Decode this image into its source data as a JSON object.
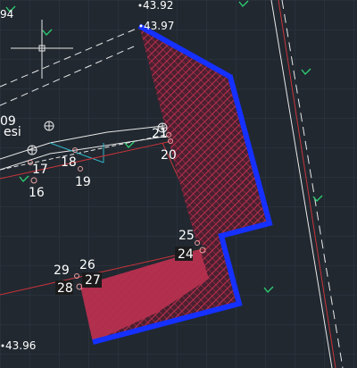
{
  "cad": {
    "elevations": {
      "top_left": "94",
      "top_mark_1": "43.92",
      "top_mark_2": "43.97",
      "bottom_left": "43.96"
    },
    "point_labels": {
      "p09": "09",
      "p16": "16",
      "p17": "17",
      "p18": "18",
      "p19": "19",
      "p20": "20",
      "p21": "21",
      "p24": "24",
      "p25": "25",
      "p26": "26",
      "p27": "27",
      "p28": "28",
      "p29": "29"
    },
    "partial_text": "esi",
    "colors": {
      "background": "#212830",
      "grid": "#2e3944",
      "boundary_blue": "#1530ff",
      "hatch_red": "#c0304f",
      "fill_red": "#b5304f",
      "red_line": "#c8343a",
      "white_line": "#e8e8e8",
      "vegetation": "#2ecc71",
      "cyan_line": "#2fb6c8"
    },
    "icons": [
      "crosshair-cursor-icon",
      "vegetation-symbol-icon",
      "survey-point-icon"
    ]
  }
}
